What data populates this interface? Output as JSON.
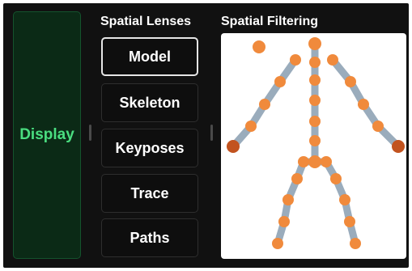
{
  "display": {
    "label": "Display"
  },
  "lenses": {
    "title": "Spatial Lenses",
    "items": [
      {
        "label": "Model",
        "selected": true
      },
      {
        "label": "Skeleton",
        "selected": false
      },
      {
        "label": "Keyposes",
        "selected": false
      },
      {
        "label": "Trace",
        "selected": false
      },
      {
        "label": "Paths",
        "selected": false
      }
    ]
  },
  "filtering": {
    "title": "Spatial Filtering"
  },
  "colors": {
    "accent_green": "#4ade80",
    "joint": "#f08a3c",
    "joint_dark": "#c2531f",
    "bone": "#9aacbc"
  }
}
